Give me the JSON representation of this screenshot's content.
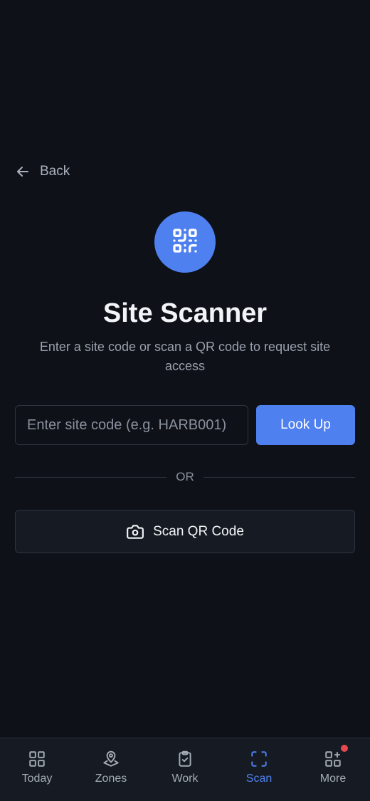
{
  "back": {
    "label": "Back",
    "icon": "arrow-left-icon"
  },
  "header": {
    "icon": "qr-code-icon",
    "title": "Site Scanner",
    "subtitle": "Enter a site code or scan a QR code to request site access"
  },
  "lookup": {
    "placeholder": "Enter site code (e.g. HARB001)",
    "value": "",
    "button_label": "Look Up"
  },
  "divider": {
    "label": "OR"
  },
  "scan": {
    "icon": "camera-icon",
    "label": "Scan QR Code"
  },
  "nav": {
    "active": "Scan",
    "items": [
      {
        "label": "Today",
        "icon": "grid-icon"
      },
      {
        "label": "Zones",
        "icon": "map-pin-icon"
      },
      {
        "label": "Work",
        "icon": "clipboard-check-icon"
      },
      {
        "label": "Scan",
        "icon": "scan-frame-icon"
      },
      {
        "label": "More",
        "icon": "apps-icon",
        "has_notification": true
      }
    ]
  },
  "colors": {
    "background": "#0e1117",
    "accent": "#4f80f0",
    "surface": "#161b23",
    "border": "#2e343e",
    "notification": "#e5484d"
  }
}
